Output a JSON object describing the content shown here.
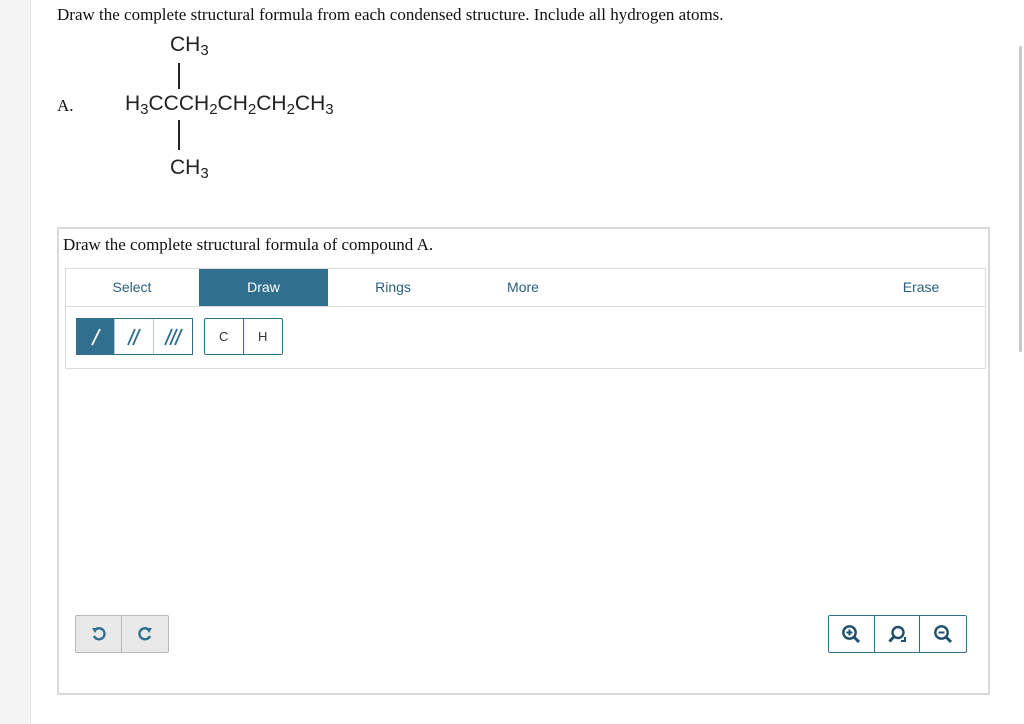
{
  "question": {
    "instruction": "Draw the complete structural formula from each condensed structure. Include all hydrogen atoms.",
    "part_label": "A.",
    "formula": {
      "top_group": {
        "main": "CH",
        "sub": "3"
      },
      "chain": [
        {
          "main": "H",
          "sub": "3"
        },
        {
          "main": "CCCH",
          "sub": "2"
        },
        {
          "main": "CH",
          "sub": "2"
        },
        {
          "main": "CH",
          "sub": "2"
        },
        {
          "main": "CH",
          "sub": "3"
        }
      ],
      "bottom_group": {
        "main": "CH",
        "sub": "3"
      }
    }
  },
  "editor": {
    "title": "Draw the complete structural formula of compound A.",
    "tabs": {
      "select": "Select",
      "draw": "Draw",
      "rings": "Rings",
      "more": "More",
      "erase": "Erase"
    },
    "active_tab": "Draw",
    "bond_tools": [
      "single-bond-icon",
      "double-bond-icon",
      "triple-bond-icon"
    ],
    "atoms": {
      "carbon": "C",
      "hydrogen": "H"
    },
    "undo_icons": [
      "undo-icon",
      "redo-icon"
    ],
    "zoom_icons": [
      "zoom-in-icon",
      "reset-zoom-icon",
      "zoom-out-icon"
    ]
  },
  "colors": {
    "accent": "#316f8e",
    "text": "#111111",
    "border": "#d9d9d9"
  }
}
